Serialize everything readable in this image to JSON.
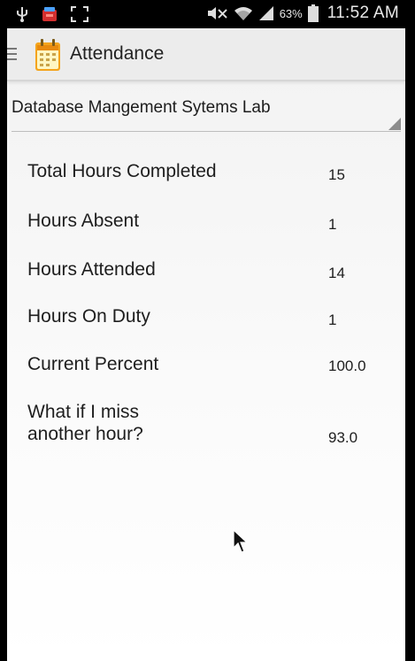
{
  "status_bar": {
    "battery_percent": "63%",
    "time": "11:52 AM",
    "icons": [
      "usb-icon",
      "app-notification-icon",
      "screenshot-icon",
      "mute-icon",
      "wifi-icon",
      "signal-icon",
      "battery-icon"
    ]
  },
  "app_bar": {
    "title": "Attendance",
    "icon": "calendar-icon"
  },
  "spinner": {
    "selected": "Database Mangement Sytems Lab"
  },
  "stats": [
    {
      "label": "Total Hours Completed",
      "value": "15"
    },
    {
      "label": "Hours Absent",
      "value": "1"
    },
    {
      "label": "Hours Attended",
      "value": "14"
    },
    {
      "label": "Hours On Duty",
      "value": "1"
    },
    {
      "label": "Current Percent",
      "value": "100.0"
    },
    {
      "label": "What if I miss another hour?",
      "value": "93.0"
    }
  ],
  "colors": {
    "app_background": "#f2f2f2",
    "action_bar": "#ececec",
    "text": "#1e1e1e",
    "status_bar": "#000000"
  }
}
